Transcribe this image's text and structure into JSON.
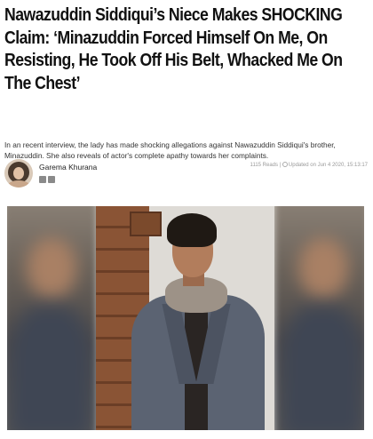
{
  "article": {
    "headline": "Nawazuddin Siddiqui’s Niece Makes SHOCKING Claim: ‘Minazuddin Forced Himself On Me, On Resisting, He Took Off His Belt, Whacked Me On The Chest’",
    "summary": "In an recent interview, the lady has made shocking allegations against Nawazuddin Siddiqui's brother, Minazuddin. She also reveals of actor's complete apathy towards her complaints.",
    "reads": "1115 Reads |",
    "updated": "Updated on Jun 4 2020, 15:13:17"
  },
  "author": {
    "name": "Garema Khurana",
    "social_icons": [
      "social-icon-1",
      "social-icon-2"
    ]
  },
  "hero_image": {
    "alt": "Nawazuddin Siddiqui photo"
  }
}
